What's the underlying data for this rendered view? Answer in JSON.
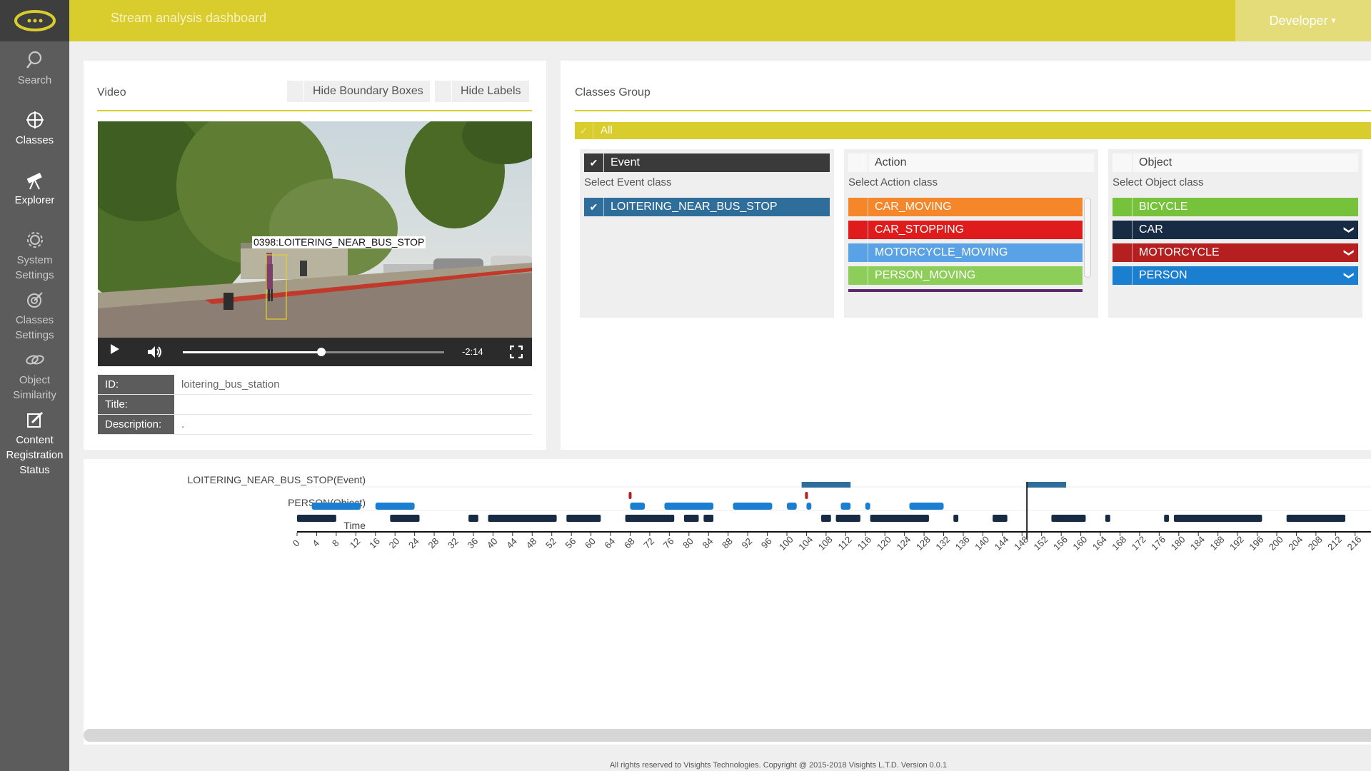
{
  "colors": {
    "accent": "#d9cd2e",
    "sidebar": "#5c5c5c",
    "event_blue": "#2f6d9b",
    "object_navy": "#172b45",
    "person_blue": "#1a7fd0",
    "red_marker": "#b51f1f"
  },
  "app": {
    "title": "Stream analysis dashboard",
    "user": "Developer"
  },
  "sidebar": {
    "items": [
      {
        "name": "nav-search",
        "icon": "search-icon",
        "label": "Search",
        "active": false
      },
      {
        "name": "nav-classes",
        "icon": "crosshair-icon",
        "label": "Classes",
        "active": true
      },
      {
        "name": "nav-explorer",
        "icon": "telescope-icon",
        "label": "Explorer",
        "active": true
      },
      {
        "name": "nav-system-settings",
        "icon": "gear-icon",
        "label": "System Settings",
        "active": false
      },
      {
        "name": "nav-classes-settings",
        "icon": "target-gear-icon",
        "label": "Classes Settings",
        "active": false
      },
      {
        "name": "nav-object-similarity",
        "icon": "link-icon",
        "label": "Object Similarity",
        "active": false
      },
      {
        "name": "nav-content-registration",
        "icon": "edit-icon",
        "label": "Content Registration Status",
        "active": true
      }
    ]
  },
  "video": {
    "title": "Video",
    "hide_boxes": "Hide Boundary Boxes",
    "hide_labels": "Hide Labels",
    "overlay_label": "0398:LOITERING_NEAR_BUS_STOP",
    "time_remaining": "-2:14",
    "progress": 0.53,
    "meta": [
      {
        "key": "ID:",
        "value": "loitering_bus_station"
      },
      {
        "key": "Title:",
        "value": ""
      },
      {
        "key": "Description:",
        "value": "."
      }
    ]
  },
  "classes": {
    "title": "Classes Group",
    "all_label": "All",
    "groups": [
      {
        "name": "Event",
        "sub": "Select Event class",
        "checked": true,
        "items": [
          {
            "label": "LOITERING_NEAR_BUS_STOP",
            "color": "#2f6d9b",
            "checked": true,
            "caret": false
          }
        ]
      },
      {
        "name": "Action",
        "sub": "Select Action class",
        "checked": false,
        "items": [
          {
            "label": "CAR_MOVING",
            "color": "#f5862a",
            "checked": false,
            "caret": false
          },
          {
            "label": "CAR_STOPPING",
            "color": "#e01b1b",
            "checked": false,
            "caret": false
          },
          {
            "label": "MOTORCYCLE_MOVING",
            "color": "#5aa2e6",
            "checked": false,
            "caret": false
          },
          {
            "label": "PERSON_MOVING",
            "color": "#8dcd59",
            "checked": false,
            "caret": false
          }
        ]
      },
      {
        "name": "Object",
        "sub": "Select Object class",
        "checked": false,
        "items": [
          {
            "label": "BICYCLE",
            "color": "#77c23b",
            "checked": false,
            "caret": false
          },
          {
            "label": "CAR",
            "color": "#172b45",
            "checked": false,
            "caret": true
          },
          {
            "label": "MOTORCYCLE",
            "color": "#b51f1f",
            "checked": false,
            "caret": true
          },
          {
            "label": "PERSON",
            "color": "#1a7fd0",
            "checked": false,
            "caret": true
          }
        ]
      }
    ]
  },
  "timeline": {
    "rows": [
      "LOITERING_NEAR_BUS_STOP(Event)",
      "PERSON(Object)",
      "Time"
    ],
    "ticks": [
      0,
      4,
      8,
      12,
      16,
      20,
      24,
      28,
      32,
      36,
      40,
      44,
      48,
      52,
      56,
      60,
      64,
      68,
      72,
      76,
      80,
      84,
      88,
      92,
      96,
      100,
      104,
      108,
      112,
      116,
      120,
      124,
      128,
      132,
      136,
      140,
      144,
      148,
      152,
      156,
      160,
      164,
      168,
      172,
      176,
      180,
      184,
      188,
      192,
      196,
      200,
      204,
      208,
      212,
      216
    ],
    "cursor_time": 149,
    "event_segments": [
      [
        103,
        113
      ],
      [
        149,
        157
      ]
    ],
    "person_top_segments": [
      [
        3,
        13
      ],
      [
        16,
        24
      ],
      [
        68,
        71
      ],
      [
        75,
        85
      ],
      [
        89,
        97
      ],
      [
        100,
        102
      ],
      [
        104,
        105
      ],
      [
        111,
        113
      ],
      [
        116,
        117
      ],
      [
        125,
        132
      ]
    ],
    "person_top_markers": [
      [
        68,
        "#b51f1f"
      ],
      [
        104,
        "#b51f1f"
      ]
    ],
    "person_bottom_segments": [
      [
        0,
        8
      ],
      [
        19,
        25
      ],
      [
        35,
        37
      ],
      [
        39,
        53
      ],
      [
        55,
        62
      ],
      [
        67,
        77
      ],
      [
        79,
        82
      ],
      [
        83,
        85
      ],
      [
        107,
        109
      ],
      [
        110,
        115
      ],
      [
        117,
        129
      ],
      [
        134,
        135
      ],
      [
        142,
        145
      ],
      [
        154,
        161
      ],
      [
        165,
        166
      ],
      [
        177,
        178
      ],
      [
        179,
        197
      ],
      [
        202,
        214
      ]
    ],
    "tick_labels_visible": true
  },
  "footer": "All rights reserved to Visights Technologies. Copyright @ 2015-2018 Visights L.T.D. Version 0.0.1"
}
